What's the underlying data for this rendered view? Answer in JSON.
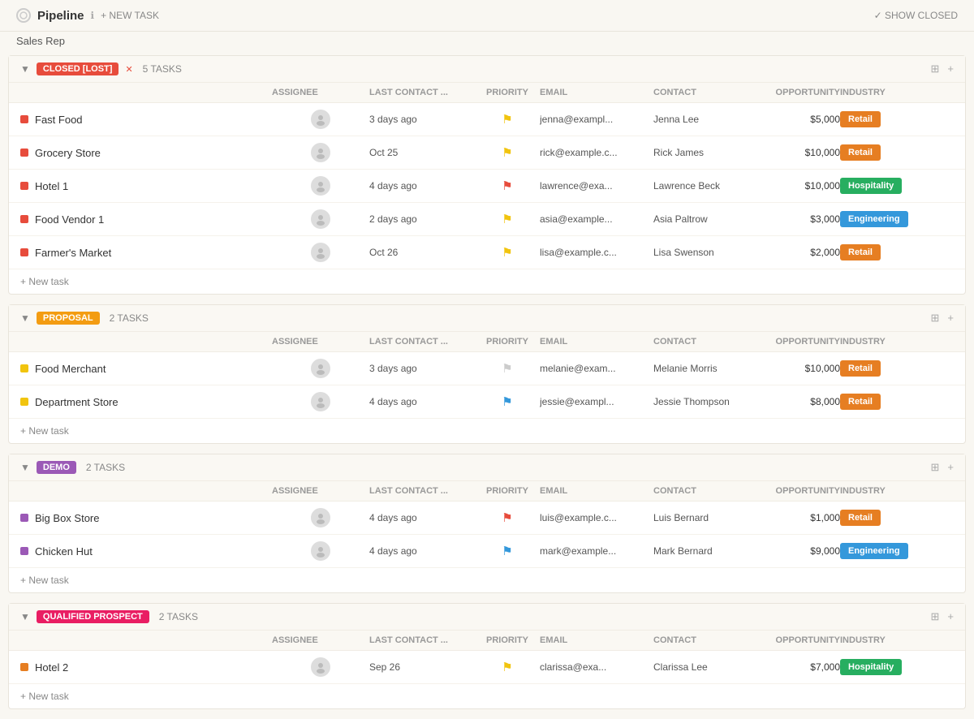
{
  "header": {
    "title": "Pipeline",
    "new_task_label": "+ NEW TASK",
    "show_closed_label": "✓ SHOW CLOSED",
    "subtitle": "Sales Rep"
  },
  "columns": {
    "name": "",
    "assignee": "ASSIGNEE",
    "last_contact": "LAST CONTACT ...",
    "priority": "PRIORITY",
    "email": "EMAIL",
    "contact": "CONTACT",
    "opportunity": "OPPORTUNITY",
    "industry": "INDUSTRY"
  },
  "sections": [
    {
      "id": "closed-lost",
      "badge": "CLOSED [LOST]",
      "badge_class": "badge-closed",
      "task_count": "5 TASKS",
      "rows": [
        {
          "name": "Fast Food",
          "dot": "dot-red",
          "assignee": "avatar",
          "last_contact": "3 days ago",
          "priority_class": "flag-yellow",
          "email": "jenna@exampl...",
          "contact": "Jenna Lee",
          "opportunity": "$5,000",
          "industry": "Retail",
          "industry_class": "ind-retail"
        },
        {
          "name": "Grocery Store",
          "dot": "dot-red",
          "assignee": "avatar",
          "last_contact": "Oct 25",
          "priority_class": "flag-yellow",
          "email": "rick@example.c...",
          "contact": "Rick James",
          "opportunity": "$10,000",
          "industry": "Retail",
          "industry_class": "ind-retail"
        },
        {
          "name": "Hotel 1",
          "dot": "dot-red",
          "assignee": "avatar",
          "last_contact": "4 days ago",
          "priority_class": "flag-red",
          "email": "lawrence@exa...",
          "contact": "Lawrence Beck",
          "opportunity": "$10,000",
          "industry": "Hospitality",
          "industry_class": "ind-hospitality"
        },
        {
          "name": "Food Vendor 1",
          "dot": "dot-red",
          "assignee": "avatar",
          "last_contact": "2 days ago",
          "priority_class": "flag-yellow",
          "email": "asia@example...",
          "contact": "Asia Paltrow",
          "opportunity": "$3,000",
          "industry": "Engineering",
          "industry_class": "ind-engineering"
        },
        {
          "name": "Farmer's Market",
          "dot": "dot-red",
          "assignee": "avatar",
          "last_contact": "Oct 26",
          "priority_class": "flag-yellow",
          "email": "lisa@example.c...",
          "contact": "Lisa Swenson",
          "opportunity": "$2,000",
          "industry": "Retail",
          "industry_class": "ind-retail"
        }
      ],
      "new_task_label": "+ New task"
    },
    {
      "id": "proposal",
      "badge": "PROPOSAL",
      "badge_class": "badge-proposal",
      "task_count": "2 TASKS",
      "rows": [
        {
          "name": "Food Merchant",
          "dot": "dot-yellow",
          "assignee": "avatar",
          "last_contact": "3 days ago",
          "priority_class": "flag-grey",
          "email": "melanie@exam...",
          "contact": "Melanie Morris",
          "opportunity": "$10,000",
          "industry": "Retail",
          "industry_class": "ind-retail"
        },
        {
          "name": "Department Store",
          "dot": "dot-yellow",
          "assignee": "avatar",
          "last_contact": "4 days ago",
          "priority_class": "flag-blue",
          "email": "jessie@exampl...",
          "contact": "Jessie Thompson",
          "opportunity": "$8,000",
          "industry": "Retail",
          "industry_class": "ind-retail"
        }
      ],
      "new_task_label": "+ New task"
    },
    {
      "id": "demo",
      "badge": "DEMO",
      "badge_class": "badge-demo",
      "task_count": "2 TASKS",
      "rows": [
        {
          "name": "Big Box Store",
          "dot": "dot-purple",
          "assignee": "avatar",
          "last_contact": "4 days ago",
          "priority_class": "flag-red",
          "email": "luis@example.c...",
          "contact": "Luis Bernard",
          "opportunity": "$1,000",
          "industry": "Retail",
          "industry_class": "ind-retail"
        },
        {
          "name": "Chicken Hut",
          "dot": "dot-purple",
          "assignee": "avatar",
          "last_contact": "4 days ago",
          "priority_class": "flag-blue",
          "email": "mark@example...",
          "contact": "Mark Bernard",
          "opportunity": "$9,000",
          "industry": "Engineering",
          "industry_class": "ind-engineering"
        }
      ],
      "new_task_label": "+ New task"
    },
    {
      "id": "qualified-prospect",
      "badge": "QUALIFIED PROSPECT",
      "badge_class": "badge-qualified",
      "task_count": "2 TASKS",
      "rows": [
        {
          "name": "Hotel 2",
          "dot": "dot-orange",
          "assignee": "avatar",
          "last_contact": "Sep 26",
          "priority_class": "flag-yellow",
          "email": "clarissa@exa...",
          "contact": "Clarissa Lee",
          "opportunity": "$7,000",
          "industry": "Hospitality",
          "industry_class": "ind-hospitality"
        }
      ],
      "new_task_label": "+ New task"
    }
  ]
}
